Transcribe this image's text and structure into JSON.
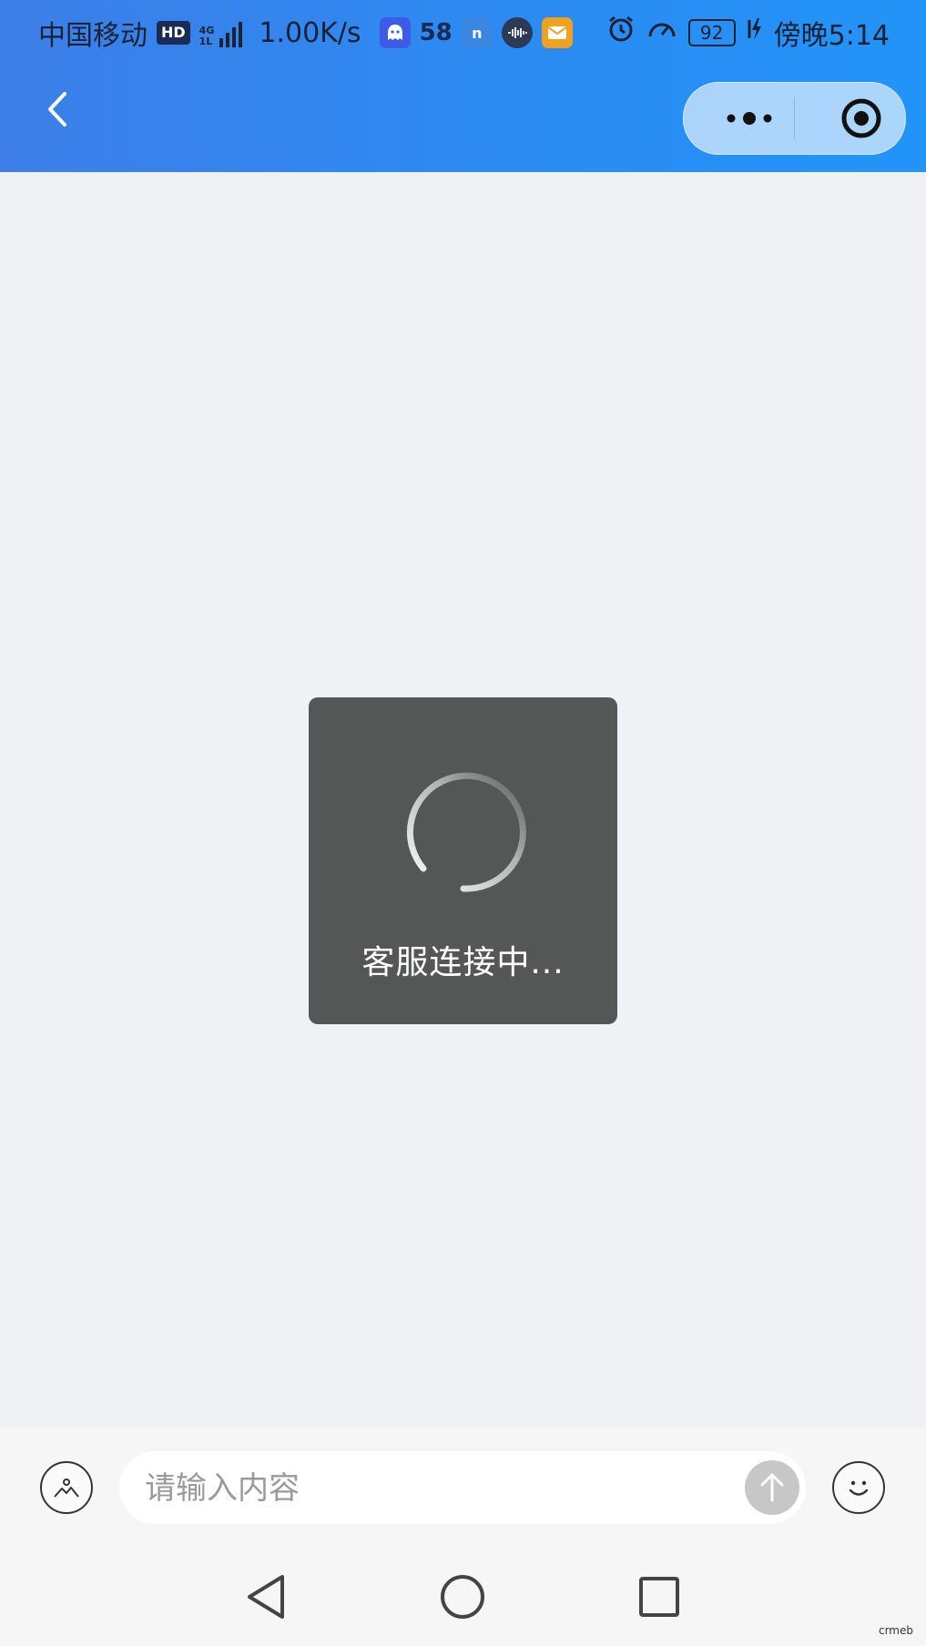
{
  "status_bar": {
    "carrier": "中国移动",
    "hd_badge": "HD",
    "network_type": "4G",
    "network_sub": "1L",
    "speed": "1.00K/s",
    "app_badges": [
      {
        "label": "",
        "icon": "ghost-app-icon",
        "color": "#3d5be8"
      },
      {
        "label": "58",
        "icon": "58-app-icon",
        "color": ""
      },
      {
        "label": "n",
        "icon": "n-app-icon",
        "color": "#3b86e0"
      },
      {
        "label": "",
        "icon": "audio-app-icon",
        "color": "#2d3a55"
      },
      {
        "label": "",
        "icon": "mail-app-icon",
        "color": "#f0a21e"
      }
    ],
    "battery": "92",
    "time": "傍晚5:14"
  },
  "nav": {
    "back_icon": "back-arrow-icon",
    "more_icon": "more-dots-icon",
    "close_icon": "target-close-icon"
  },
  "loading": {
    "text": "客服连接中..."
  },
  "input": {
    "placeholder": "请输入内容",
    "image_icon": "image-icon",
    "send_icon": "send-arrow-icon",
    "emoji_icon": "emoji-icon"
  },
  "colors": {
    "header_start": "#3d7ee8",
    "header_end": "#2294f8",
    "toast_bg": "#555656",
    "page_bg": "#eff1f4"
  },
  "watermark": "crmeb"
}
